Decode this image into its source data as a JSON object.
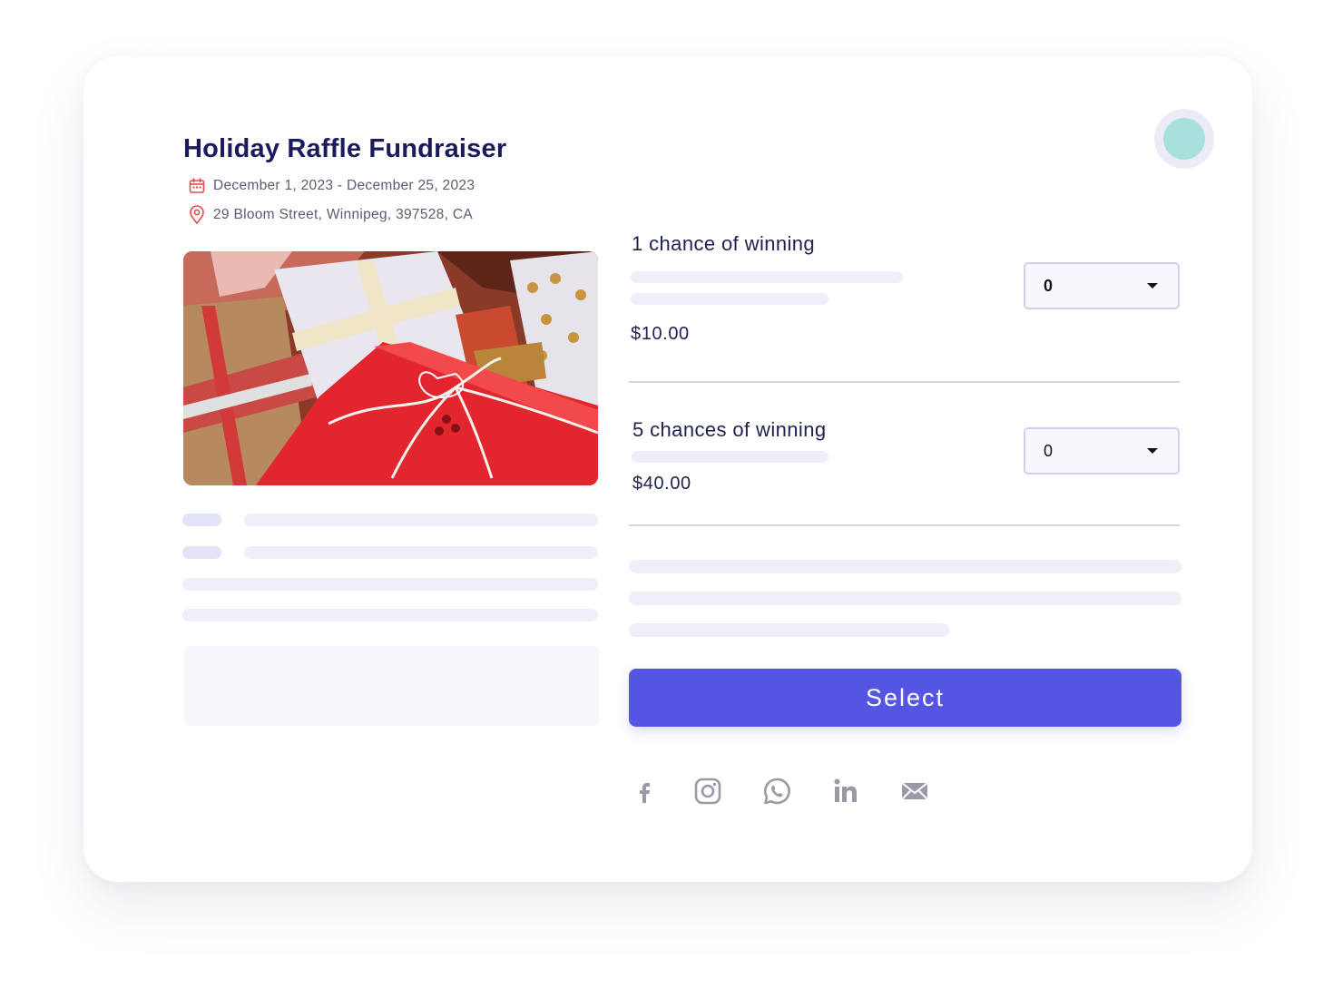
{
  "event": {
    "title": "Holiday Raffle Fundraiser",
    "dates": "December 1, 2023 - December 25, 2023",
    "location": "29 Bloom Street, Winnipeg, 397528, CA"
  },
  "tiers": [
    {
      "name": "1 chance of winning",
      "price": "$10.00",
      "quantity": "0"
    },
    {
      "name": "5 chances of winning",
      "price": "$40.00",
      "quantity": "0"
    }
  ],
  "actions": {
    "select_label": "Select"
  },
  "share_icons": [
    "facebook-icon",
    "instagram-icon",
    "whatsapp-icon",
    "linkedin-icon",
    "email-icon"
  ],
  "colors": {
    "accent": "#5555e3",
    "title": "#191b5c",
    "icon_red": "#e44b4b",
    "share_gray": "#9a9aa6",
    "avatar": "#a9e0dc"
  }
}
